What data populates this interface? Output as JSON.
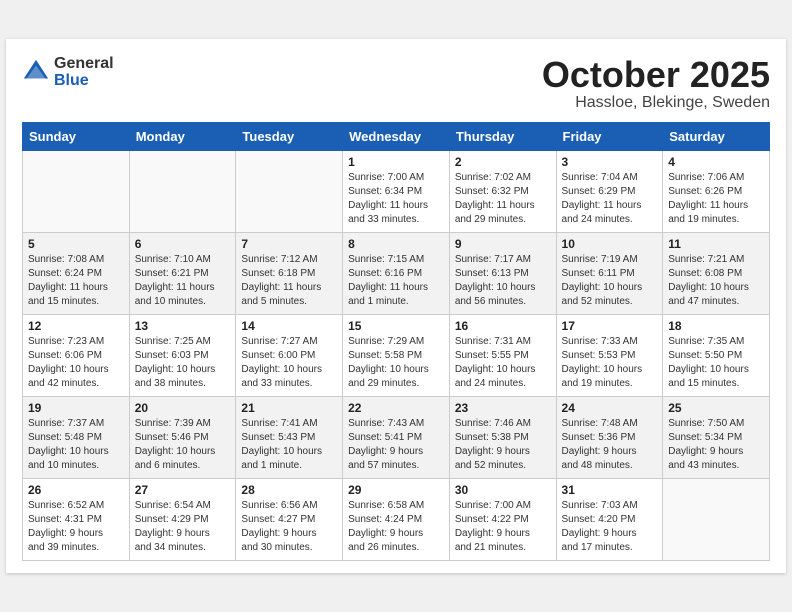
{
  "header": {
    "logo_general": "General",
    "logo_blue": "Blue",
    "month": "October 2025",
    "location": "Hassloe, Blekinge, Sweden"
  },
  "days_of_week": [
    "Sunday",
    "Monday",
    "Tuesday",
    "Wednesday",
    "Thursday",
    "Friday",
    "Saturday"
  ],
  "weeks": [
    [
      {
        "day": "",
        "info": "",
        "empty": true
      },
      {
        "day": "",
        "info": "",
        "empty": true
      },
      {
        "day": "",
        "info": "",
        "empty": true
      },
      {
        "day": "1",
        "info": "Sunrise: 7:00 AM\nSunset: 6:34 PM\nDaylight: 11 hours\nand 33 minutes."
      },
      {
        "day": "2",
        "info": "Sunrise: 7:02 AM\nSunset: 6:32 PM\nDaylight: 11 hours\nand 29 minutes."
      },
      {
        "day": "3",
        "info": "Sunrise: 7:04 AM\nSunset: 6:29 PM\nDaylight: 11 hours\nand 24 minutes."
      },
      {
        "day": "4",
        "info": "Sunrise: 7:06 AM\nSunset: 6:26 PM\nDaylight: 11 hours\nand 19 minutes."
      }
    ],
    [
      {
        "day": "5",
        "info": "Sunrise: 7:08 AM\nSunset: 6:24 PM\nDaylight: 11 hours\nand 15 minutes."
      },
      {
        "day": "6",
        "info": "Sunrise: 7:10 AM\nSunset: 6:21 PM\nDaylight: 11 hours\nand 10 minutes."
      },
      {
        "day": "7",
        "info": "Sunrise: 7:12 AM\nSunset: 6:18 PM\nDaylight: 11 hours\nand 5 minutes."
      },
      {
        "day": "8",
        "info": "Sunrise: 7:15 AM\nSunset: 6:16 PM\nDaylight: 11 hours\nand 1 minute."
      },
      {
        "day": "9",
        "info": "Sunrise: 7:17 AM\nSunset: 6:13 PM\nDaylight: 10 hours\nand 56 minutes."
      },
      {
        "day": "10",
        "info": "Sunrise: 7:19 AM\nSunset: 6:11 PM\nDaylight: 10 hours\nand 52 minutes."
      },
      {
        "day": "11",
        "info": "Sunrise: 7:21 AM\nSunset: 6:08 PM\nDaylight: 10 hours\nand 47 minutes."
      }
    ],
    [
      {
        "day": "12",
        "info": "Sunrise: 7:23 AM\nSunset: 6:06 PM\nDaylight: 10 hours\nand 42 minutes."
      },
      {
        "day": "13",
        "info": "Sunrise: 7:25 AM\nSunset: 6:03 PM\nDaylight: 10 hours\nand 38 minutes."
      },
      {
        "day": "14",
        "info": "Sunrise: 7:27 AM\nSunset: 6:00 PM\nDaylight: 10 hours\nand 33 minutes."
      },
      {
        "day": "15",
        "info": "Sunrise: 7:29 AM\nSunset: 5:58 PM\nDaylight: 10 hours\nand 29 minutes."
      },
      {
        "day": "16",
        "info": "Sunrise: 7:31 AM\nSunset: 5:55 PM\nDaylight: 10 hours\nand 24 minutes."
      },
      {
        "day": "17",
        "info": "Sunrise: 7:33 AM\nSunset: 5:53 PM\nDaylight: 10 hours\nand 19 minutes."
      },
      {
        "day": "18",
        "info": "Sunrise: 7:35 AM\nSunset: 5:50 PM\nDaylight: 10 hours\nand 15 minutes."
      }
    ],
    [
      {
        "day": "19",
        "info": "Sunrise: 7:37 AM\nSunset: 5:48 PM\nDaylight: 10 hours\nand 10 minutes."
      },
      {
        "day": "20",
        "info": "Sunrise: 7:39 AM\nSunset: 5:46 PM\nDaylight: 10 hours\nand 6 minutes."
      },
      {
        "day": "21",
        "info": "Sunrise: 7:41 AM\nSunset: 5:43 PM\nDaylight: 10 hours\nand 1 minute."
      },
      {
        "day": "22",
        "info": "Sunrise: 7:43 AM\nSunset: 5:41 PM\nDaylight: 9 hours\nand 57 minutes."
      },
      {
        "day": "23",
        "info": "Sunrise: 7:46 AM\nSunset: 5:38 PM\nDaylight: 9 hours\nand 52 minutes."
      },
      {
        "day": "24",
        "info": "Sunrise: 7:48 AM\nSunset: 5:36 PM\nDaylight: 9 hours\nand 48 minutes."
      },
      {
        "day": "25",
        "info": "Sunrise: 7:50 AM\nSunset: 5:34 PM\nDaylight: 9 hours\nand 43 minutes."
      }
    ],
    [
      {
        "day": "26",
        "info": "Sunrise: 6:52 AM\nSunset: 4:31 PM\nDaylight: 9 hours\nand 39 minutes."
      },
      {
        "day": "27",
        "info": "Sunrise: 6:54 AM\nSunset: 4:29 PM\nDaylight: 9 hours\nand 34 minutes."
      },
      {
        "day": "28",
        "info": "Sunrise: 6:56 AM\nSunset: 4:27 PM\nDaylight: 9 hours\nand 30 minutes."
      },
      {
        "day": "29",
        "info": "Sunrise: 6:58 AM\nSunset: 4:24 PM\nDaylight: 9 hours\nand 26 minutes."
      },
      {
        "day": "30",
        "info": "Sunrise: 7:00 AM\nSunset: 4:22 PM\nDaylight: 9 hours\nand 21 minutes."
      },
      {
        "day": "31",
        "info": "Sunrise: 7:03 AM\nSunset: 4:20 PM\nDaylight: 9 hours\nand 17 minutes."
      },
      {
        "day": "",
        "info": "",
        "empty": true
      }
    ]
  ]
}
